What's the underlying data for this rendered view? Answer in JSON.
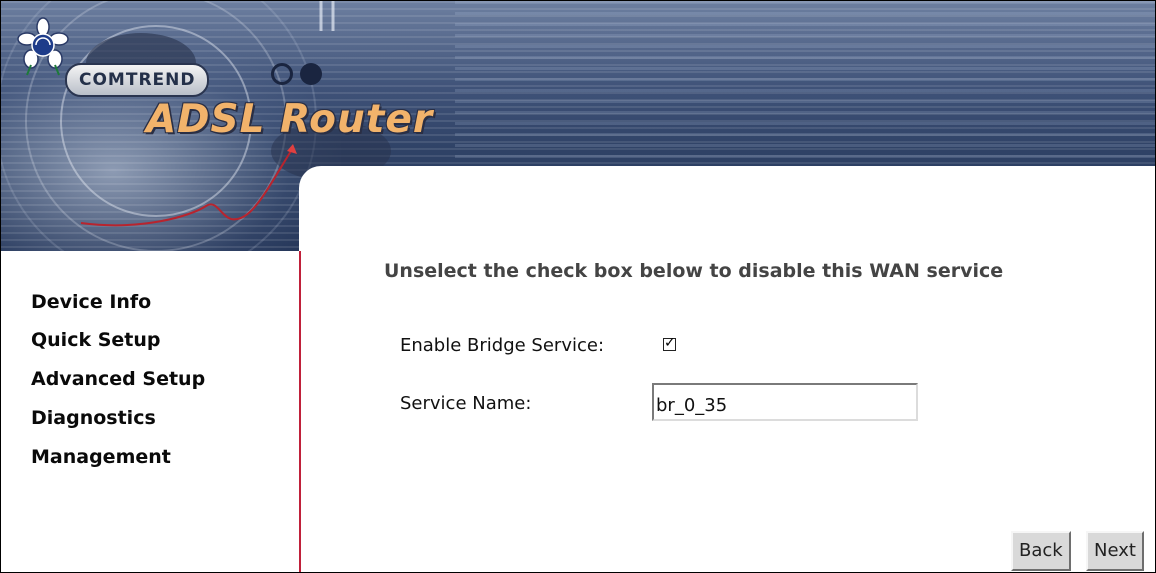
{
  "banner": {
    "brand": "COMTREND",
    "product_title": "ADSL Router",
    "logo_icon": "comtrend-flower-logo"
  },
  "nav": {
    "items": [
      {
        "label": "Device Info"
      },
      {
        "label": "Quick Setup"
      },
      {
        "label": "Advanced Setup"
      },
      {
        "label": "Diagnostics"
      },
      {
        "label": "Management"
      }
    ]
  },
  "main": {
    "heading": "Unselect the check box below to disable this WAN service",
    "enable_bridge": {
      "label": "Enable Bridge Service:",
      "checked": true
    },
    "service_name": {
      "label": "Service Name:",
      "value": "br_0_35"
    },
    "buttons": {
      "back": "Back",
      "next": "Next"
    }
  },
  "colors": {
    "banner_dark": "#2f4266",
    "title_orange": "#f2b36b",
    "sidebar_border": "#c0203a",
    "button_face": "#d9d9d9"
  }
}
